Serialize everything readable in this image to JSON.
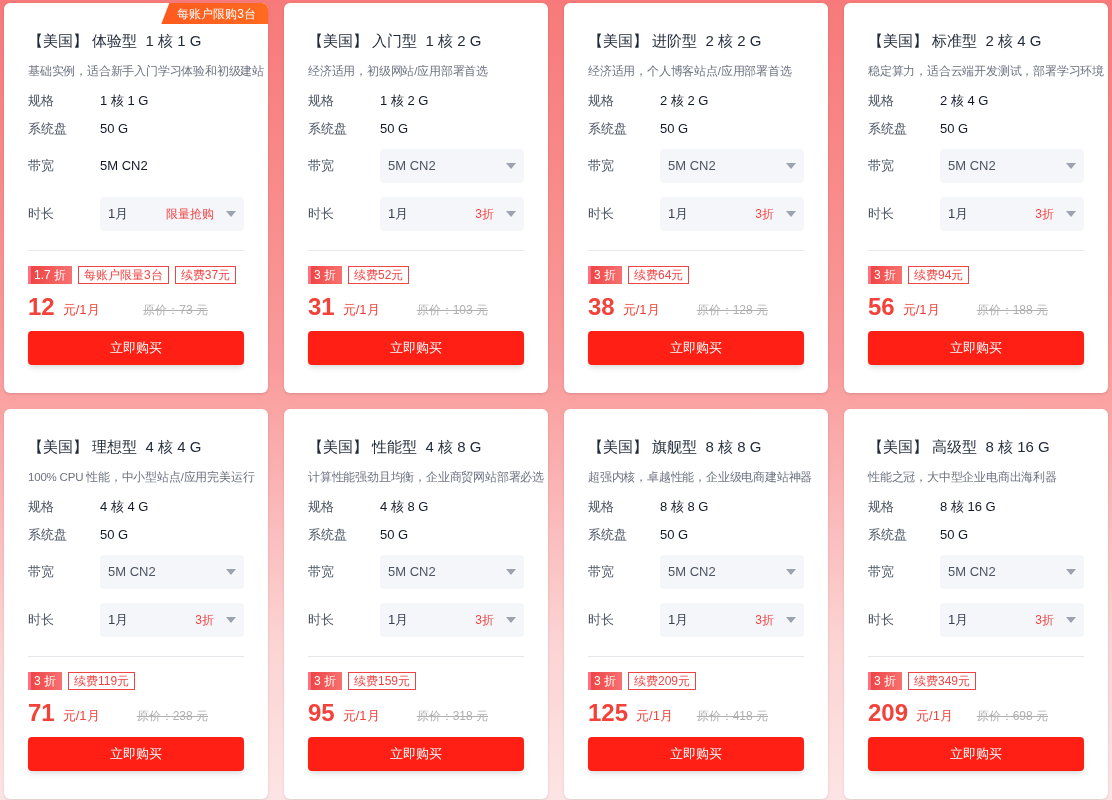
{
  "plans": [
    {
      "ribbon": "每账户限购3台",
      "title": "【美国】 体验型  1 核 1 G",
      "description": "基础实例，适合新手入门学习体验和初级建站",
      "specs": [
        {
          "label": "规格",
          "value": "1 核 1 G"
        },
        {
          "label": "系统盘",
          "value": "50 G"
        }
      ],
      "bandwidth": {
        "label": "带宽",
        "kind": "text",
        "value": "5M CN2"
      },
      "duration": {
        "label": "时长",
        "value": "1月",
        "note": "限量抢购"
      },
      "discount": "1.7 折",
      "tags": [
        "每账户限量3台",
        "续费37元"
      ],
      "price": "12",
      "unit": "元/1月",
      "original": "原价：73 元",
      "button": "立即购买"
    },
    {
      "title": "【美国】 入门型  1 核 2 G",
      "description": "经济适用，初级网站/应用部署首选",
      "specs": [
        {
          "label": "规格",
          "value": "1 核 2 G"
        },
        {
          "label": "系统盘",
          "value": "50 G"
        }
      ],
      "bandwidth": {
        "label": "带宽",
        "kind": "select",
        "value": "5M CN2"
      },
      "duration": {
        "label": "时长",
        "value": "1月",
        "note": "3折"
      },
      "discount": "3 折",
      "tags": [
        "续费52元"
      ],
      "price": "31",
      "unit": "元/1月",
      "original": "原价：103 元",
      "button": "立即购买"
    },
    {
      "title": "【美国】 进阶型  2 核 2 G",
      "description": "经济适用，个人博客站点/应用部署首选",
      "specs": [
        {
          "label": "规格",
          "value": "2 核 2 G"
        },
        {
          "label": "系统盘",
          "value": "50 G"
        }
      ],
      "bandwidth": {
        "label": "带宽",
        "kind": "select",
        "value": "5M CN2"
      },
      "duration": {
        "label": "时长",
        "value": "1月",
        "note": "3折"
      },
      "discount": "3 折",
      "tags": [
        "续费64元"
      ],
      "price": "38",
      "unit": "元/1月",
      "original": "原价：128 元",
      "button": "立即购买"
    },
    {
      "title": "【美国】 标准型  2 核 4 G",
      "description": "稳定算力，适合云端开发测试，部署学习环境",
      "specs": [
        {
          "label": "规格",
          "value": "2 核 4 G"
        },
        {
          "label": "系统盘",
          "value": "50 G"
        }
      ],
      "bandwidth": {
        "label": "带宽",
        "kind": "select",
        "value": "5M CN2"
      },
      "duration": {
        "label": "时长",
        "value": "1月",
        "note": "3折"
      },
      "discount": "3 折",
      "tags": [
        "续费94元"
      ],
      "price": "56",
      "unit": "元/1月",
      "original": "原价：188 元",
      "button": "立即购买"
    },
    {
      "title": "【美国】 理想型  4 核 4 G",
      "description": "100% CPU 性能，中小型站点/应用完美运行",
      "specs": [
        {
          "label": "规格",
          "value": "4 核 4 G"
        },
        {
          "label": "系统盘",
          "value": "50 G"
        }
      ],
      "bandwidth": {
        "label": "带宽",
        "kind": "select",
        "value": "5M CN2"
      },
      "duration": {
        "label": "时长",
        "value": "1月",
        "note": "3折"
      },
      "discount": "3 折",
      "tags": [
        "续费119元"
      ],
      "price": "71",
      "unit": "元/1月",
      "original": "原价：238 元",
      "button": "立即购买"
    },
    {
      "title": "【美国】 性能型  4 核 8 G",
      "description": "计算性能强劲且均衡，企业商贸网站部署必选",
      "specs": [
        {
          "label": "规格",
          "value": "4 核 8 G"
        },
        {
          "label": "系统盘",
          "value": "50 G"
        }
      ],
      "bandwidth": {
        "label": "带宽",
        "kind": "select",
        "value": "5M CN2"
      },
      "duration": {
        "label": "时长",
        "value": "1月",
        "note": "3折"
      },
      "discount": "3 折",
      "tags": [
        "续费159元"
      ],
      "price": "95",
      "unit": "元/1月",
      "original": "原价：318 元",
      "button": "立即购买"
    },
    {
      "title": "【美国】 旗舰型  8 核 8 G",
      "description": "超强内核，卓越性能，企业级电商建站神器",
      "specs": [
        {
          "label": "规格",
          "value": "8 核 8 G"
        },
        {
          "label": "系统盘",
          "value": "50 G"
        }
      ],
      "bandwidth": {
        "label": "带宽",
        "kind": "select",
        "value": "5M CN2"
      },
      "duration": {
        "label": "时长",
        "value": "1月",
        "note": "3折"
      },
      "discount": "3 折",
      "tags": [
        "续费209元"
      ],
      "price": "125",
      "unit": "元/1月",
      "original": "原价：418 元",
      "button": "立即购买"
    },
    {
      "title": "【美国】 高级型  8 核 16 G",
      "description": "性能之冠，大中型企业电商出海利器",
      "specs": [
        {
          "label": "规格",
          "value": "8 核 16 G"
        },
        {
          "label": "系统盘",
          "value": "50 G"
        }
      ],
      "bandwidth": {
        "label": "带宽",
        "kind": "select",
        "value": "5M CN2"
      },
      "duration": {
        "label": "时长",
        "value": "1月",
        "note": "3折"
      },
      "discount": "3 折",
      "tags": [
        "续费349元"
      ],
      "price": "209",
      "unit": "元/1月",
      "original": "原价：698 元",
      "button": "立即购买"
    }
  ]
}
